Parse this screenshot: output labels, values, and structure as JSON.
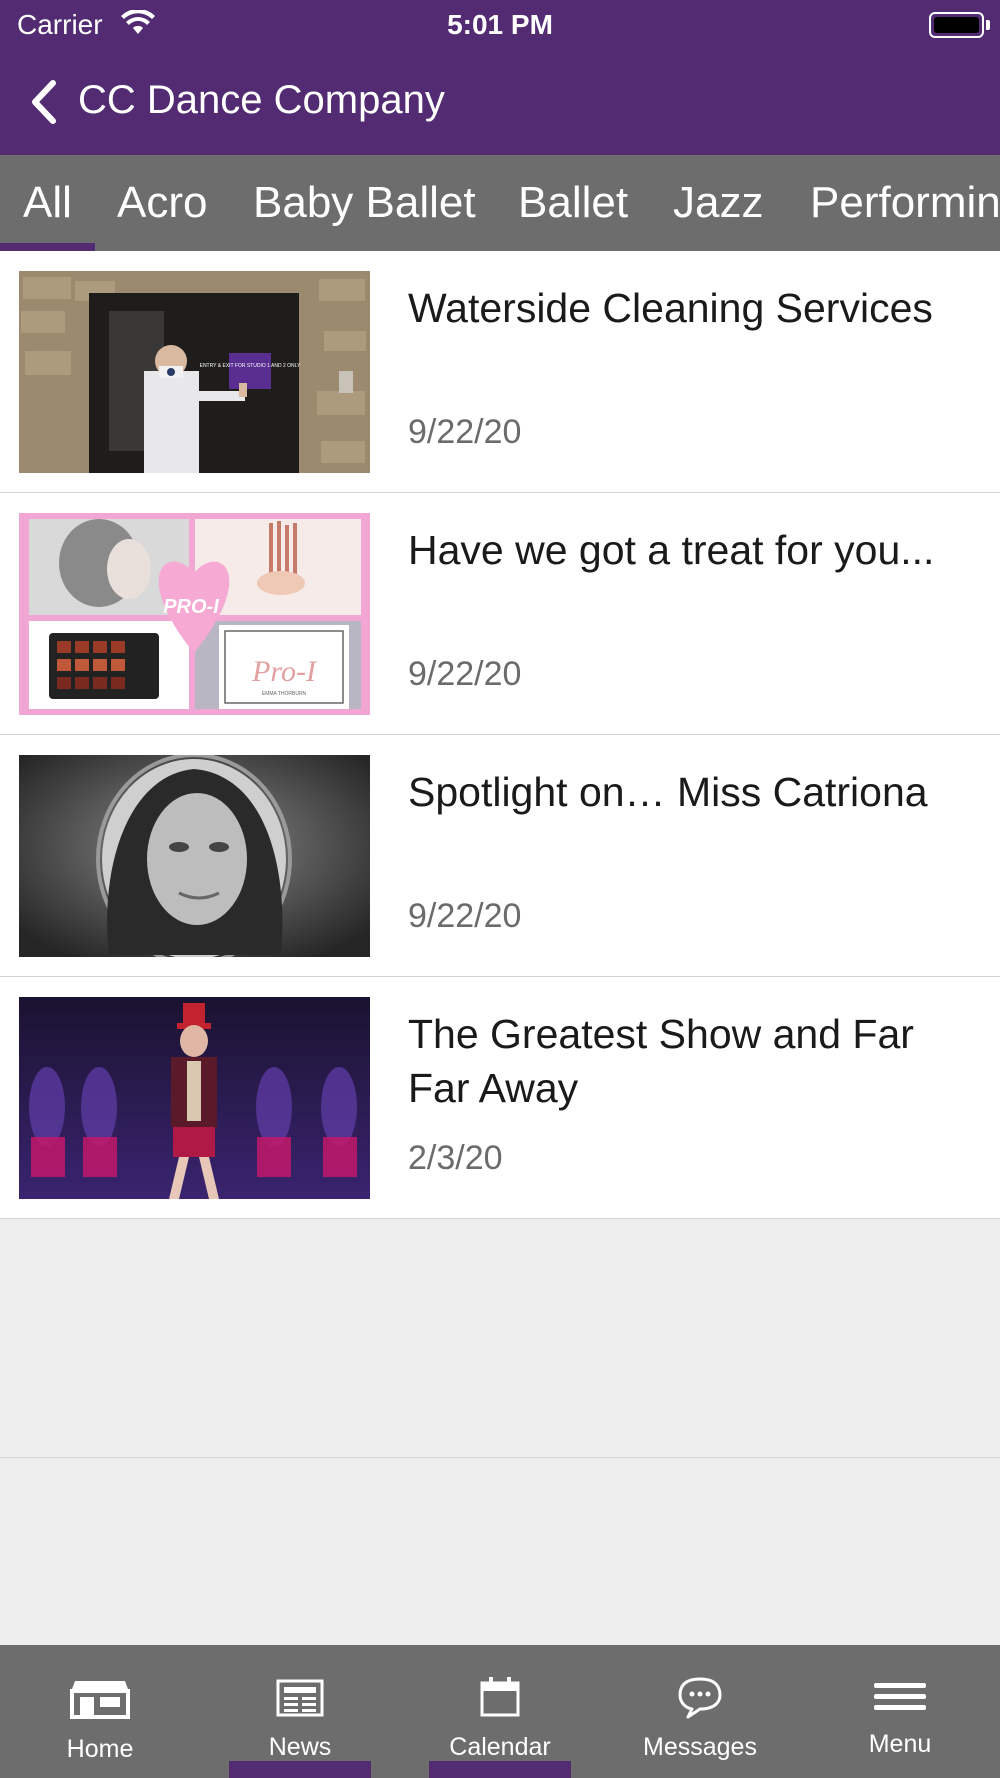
{
  "status_bar": {
    "carrier": "Carrier",
    "time": "5:01 PM"
  },
  "nav": {
    "title": "CC Dance Company",
    "back_icon": "chevron-left-icon"
  },
  "category_tabs": [
    {
      "label": "All",
      "active": true
    },
    {
      "label": "Acro",
      "active": false
    },
    {
      "label": "Baby Ballet",
      "active": false
    },
    {
      "label": "Ballet",
      "active": false
    },
    {
      "label": "Jazz",
      "active": false
    },
    {
      "label": "Performin",
      "active": false
    }
  ],
  "news": [
    {
      "title": "Waterside Cleaning Services",
      "date": "9/22/20",
      "sign_text": "ENTRY & EXIT FOR STUDIO 1 AND 2 ONLY"
    },
    {
      "title": "Have we got a treat for you...",
      "date": "9/22/20",
      "logo_text": "Pro-I",
      "badge_text": "PRO-I",
      "brand_text": "EMMA THORBURN"
    },
    {
      "title": "Spotlight on… Miss Catriona",
      "date": "9/22/20"
    },
    {
      "title": "The Greatest Show and Far Far Away",
      "date": "2/3/20"
    }
  ],
  "bottom_tabs": [
    {
      "label": "Home",
      "icon": "storefront-icon"
    },
    {
      "label": "News",
      "icon": "newspaper-icon"
    },
    {
      "label": "Calendar",
      "icon": "calendar-icon"
    },
    {
      "label": "Messages",
      "icon": "chat-bubble-icon"
    },
    {
      "label": "Menu",
      "icon": "hamburger-menu-icon"
    }
  ],
  "colors": {
    "brand_purple": "#522b72",
    "tab_gray": "#6d6d6d",
    "background": "#ededed"
  }
}
